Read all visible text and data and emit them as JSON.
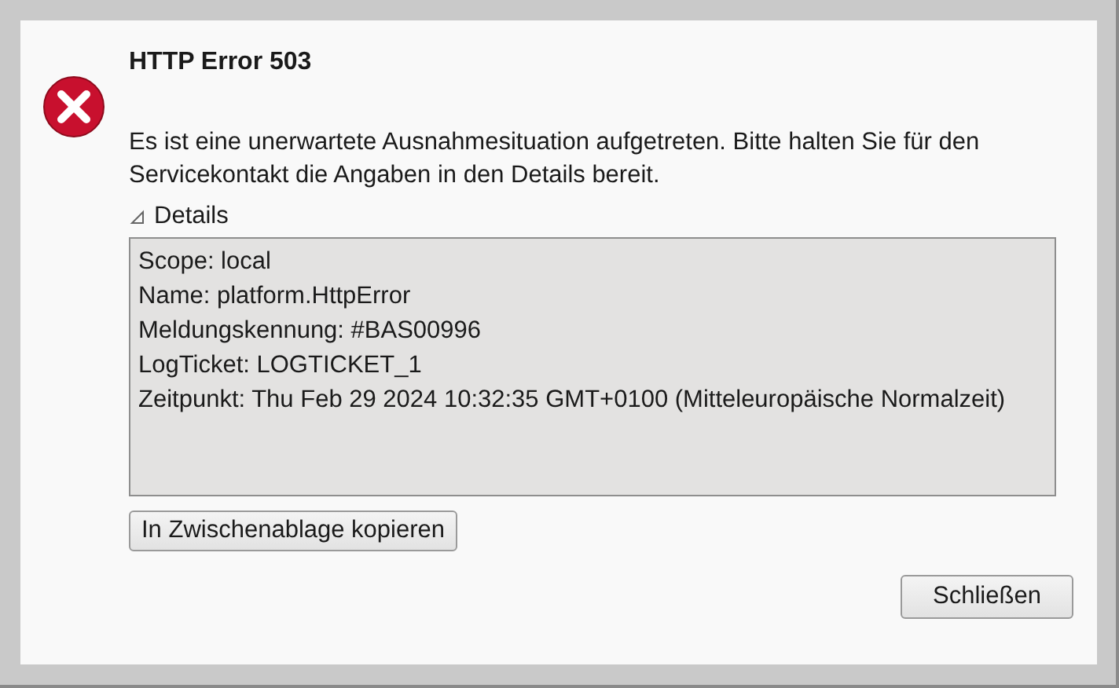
{
  "dialog": {
    "title": "HTTP Error 503",
    "message": "Es ist eine unerwartete Ausnahmesituation aufgetreten. Bitte halten Sie für den Servicekontakt die Angaben in den Details bereit.",
    "details": {
      "label": "Details",
      "expanded": true,
      "lines": [
        "Scope: local",
        "Name: platform.HttpError",
        "Meldungskennung: #BAS00996",
        "LogTicket: LOGTICKET_1",
        "Zeitpunkt: Thu Feb 29 2024 10:32:35 GMT+0100 (Mitteleuropäische Normalzeit)"
      ]
    },
    "copy_button": "In Zwischenablage kopieren",
    "close_button": "Schließen"
  }
}
